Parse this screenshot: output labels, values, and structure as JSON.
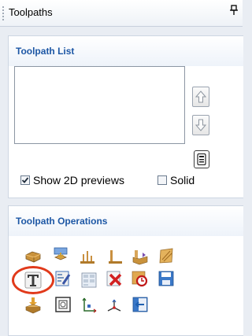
{
  "window": {
    "title": "Toolpaths"
  },
  "toolpath_list": {
    "title": "Toolpath List",
    "items": [],
    "show_2d_previews": {
      "label": "Show 2D previews",
      "checked": true
    },
    "solid": {
      "label": "Solid",
      "checked": false
    }
  },
  "toolpath_operations": {
    "title": "Toolpath Operations",
    "highlighted_tool": "texture-toolpath-icon",
    "highlight_color": "#e13a1b"
  },
  "colors": {
    "panel_title": "#1d57a5",
    "background": "#e9edf3"
  }
}
